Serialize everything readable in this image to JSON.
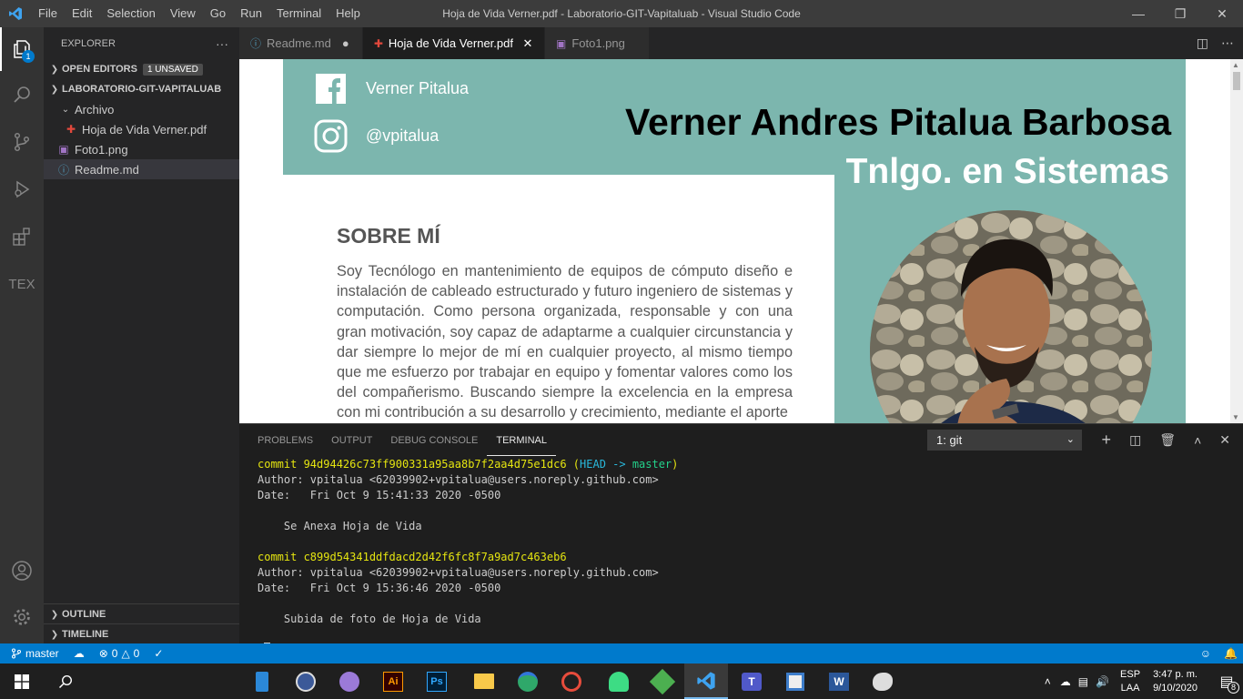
{
  "window": {
    "title": "Hoja de Vida Verner.pdf - Laboratorio-GIT-Vapitaluab - Visual Studio Code",
    "menu": [
      "File",
      "Edit",
      "Selection",
      "View",
      "Go",
      "Run",
      "Terminal",
      "Help"
    ],
    "controls": {
      "minimize": "—",
      "restore": "❐",
      "close": "✕"
    }
  },
  "activity_bar": {
    "explorer_badge": "1",
    "tex_label": "TEX"
  },
  "sidebar": {
    "title": "EXPLORER",
    "more": "···",
    "open_editors": "OPEN EDITORS",
    "unsaved_badge": "1 UNSAVED",
    "project": "LABORATORIO-GIT-VAPITALUAB",
    "folder": "Archivo",
    "files": [
      "Hoja de Vida Verner.pdf",
      "Foto1.png",
      "Readme.md"
    ],
    "outline": "OUTLINE",
    "timeline": "TIMELINE"
  },
  "tabs": [
    {
      "label": "Readme.md",
      "icon": "info-icon",
      "dirty": "●"
    },
    {
      "label": "Hoja de Vida Verner.pdf",
      "icon": "pdf-icon",
      "close": "✕"
    },
    {
      "label": "Foto1.png",
      "icon": "image-icon"
    }
  ],
  "pdf": {
    "facebook": "Verner Pitalua",
    "instagram": "@vpitalua",
    "name": "Verner Andres Pitalua Barbosa",
    "profession": "Tnlgo. en Sistemas",
    "about_heading": "SOBRE MÍ",
    "about_text": "Soy Tecnólogo en mantenimiento de equipos de cómputo diseño e instalación de cableado estructurado y futuro ingeniero de sistemas y computación. Como persona organizada, responsable y con una gran motivación, soy capaz de adaptarme a cualquier circunstancia y dar siempre lo mejor de mí en cualquier proyecto, al mismo tiempo que me esfuerzo por trabajar en equipo y fomentar valores como los del compañerismo. Buscando siempre la excelencia en la empresa con mi contribución a su desarrollo y crecimiento, mediante el aporte",
    "colors": {
      "teal": "#7cb6ae"
    }
  },
  "panel": {
    "tabs": [
      "PROBLEMS",
      "OUTPUT",
      "DEBUG CONSOLE",
      "TERMINAL"
    ],
    "active_tab": "TERMINAL",
    "terminal_select": "1: git",
    "terminal": {
      "commit1_prefix": "commit 94d94426c73ff900331a95aa8b7f2aa4d75e1dc6 (",
      "head": "HEAD -> ",
      "branch": "master",
      "commit1_suffix": ")",
      "author1": "Author: vpitalua <62039902+vpitalua@users.noreply.github.com>",
      "date1": "Date:   Fri Oct 9 15:41:33 2020 -0500",
      "msg1": "    Se Anexa Hoja de Vida",
      "commit2": "commit c899d54341ddfdacd2d42f6fc8f7a9ad7c463eb6",
      "author2": "Author: vpitalua <62039902+vpitalua@users.noreply.github.com>",
      "date2": "Date:   Fri Oct 9 15:36:46 2020 -0500",
      "msg2": "    Subida de foto de Hoja de Vida",
      "prompt": ":"
    }
  },
  "statusbar": {
    "branch": "master",
    "errors": "0",
    "warnings": "0"
  },
  "taskbar": {
    "lang_top": "ESP",
    "lang_bottom": "LAA",
    "time": "3:47 p. m.",
    "date": "9/10/2020",
    "notifications": "8"
  }
}
